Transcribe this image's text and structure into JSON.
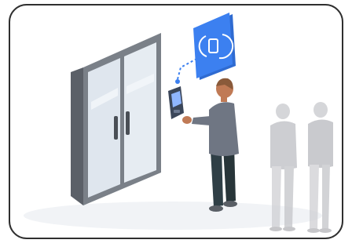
{
  "scene": {
    "subject": "door-access-control-illustration"
  },
  "colors": {
    "background": "#ffffff",
    "card_border": "#2f2f2f",
    "card_fill": "#f6f7f9",
    "icon_tile": "#3c80f0",
    "icon_tile_dark": "#2f6bd1",
    "connector": "#3c80f0",
    "door_frame": "#6f747c",
    "door_glass": "#dfe6ee",
    "shirt": "#6f7683",
    "pants": "#2f3f46",
    "skin": "#c07a55",
    "hair": "#8a5a3a",
    "reader": "#3b4659",
    "reader_screen": "#8fb6ff",
    "ghost_person": "#c8c9cd"
  },
  "icons": {
    "tile": "phone-access-icon"
  }
}
